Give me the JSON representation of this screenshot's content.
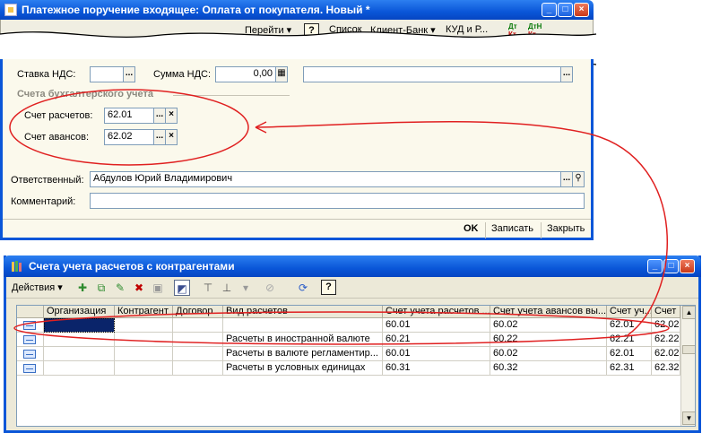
{
  "window1": {
    "title": "Платежное поручение входящее: Оплата от покупателя. Новый *",
    "toolbar": {
      "goto_label": "Перейти",
      "help_label": "?",
      "list_label": "Список",
      "client_bank_label": "Клиент-Банк",
      "kudir_label": "КУД и Р...",
      "dt_label": "Дт",
      "kt_label": "Кт",
      "dtn_label": "ДтН"
    },
    "vat": {
      "rate_label": "Ставка НДС:",
      "rate_value": "",
      "sum_label": "Сумма НДС:",
      "sum_value": "0,00"
    },
    "accounts_group": {
      "title": "Счета бухгалтерского учета",
      "settlement_label": "Счет расчетов:",
      "settlement_value": "62.01",
      "advance_label": "Счет авансов:",
      "advance_value": "62.02"
    },
    "responsible_label": "Ответственный:",
    "responsible_value": "Абдулов Юрий Владимирович",
    "comment_label": "Комментарий:",
    "comment_value": "",
    "buttons": {
      "ok": "OK",
      "save": "Записать",
      "close": "Закрыть"
    }
  },
  "window2": {
    "title": "Счета учета расчетов с контрагентами",
    "actions_label": "Действия",
    "help_label": "?",
    "columns": [
      "Организация",
      "Контрагент",
      "Договор",
      "Вид расчетов",
      "Счет учета расчетов ...",
      "Счет учета авансов вы...",
      "Счет уч...",
      "Счет ..."
    ],
    "rows": [
      [
        "",
        "",
        "",
        "",
        "60.01",
        "60.02",
        "62.01",
        "62.02"
      ],
      [
        "",
        "",
        "",
        "Расчеты в иностранной валюте",
        "60.21",
        "60.22",
        "62.21",
        "62.22"
      ],
      [
        "",
        "",
        "",
        "Расчеты в валюте регламентир...",
        "60.01",
        "60.02",
        "62.01",
        "62.02"
      ],
      [
        "",
        "",
        "",
        "Расчеты в условных единицах",
        "60.31",
        "60.32",
        "62.31",
        "62.32"
      ]
    ]
  },
  "colors": {
    "title_bar": "#0a56d8",
    "annotation": "#e02020",
    "form_bg": "#fbf9ec",
    "selection": "#0a246a"
  }
}
